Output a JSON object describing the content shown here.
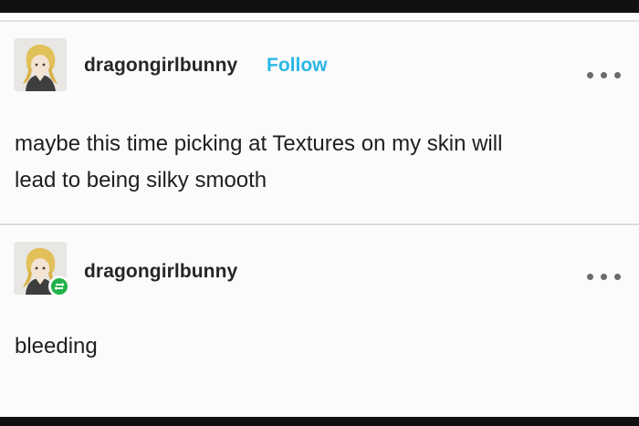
{
  "posts": [
    {
      "username": "dragongirlbunny",
      "follow_label": "Follow",
      "body_line1": "maybe this time picking at Textures on my skin will",
      "body_line2": "lead to being silky smooth",
      "avatar_icon": "anime-character-avatar-icon",
      "menu_icon": "more-options-icon"
    },
    {
      "username": "dragongirlbunny",
      "body_line1": "bleeding",
      "avatar_icon": "anime-character-avatar-icon",
      "badge_icon": "reblog-icon",
      "menu_icon": "more-options-icon"
    }
  ],
  "colors": {
    "follow_link": "#2ab7e6",
    "reblog_badge": "#22b24a",
    "text": "#1f1f1f",
    "background": "#fbfbfb"
  }
}
